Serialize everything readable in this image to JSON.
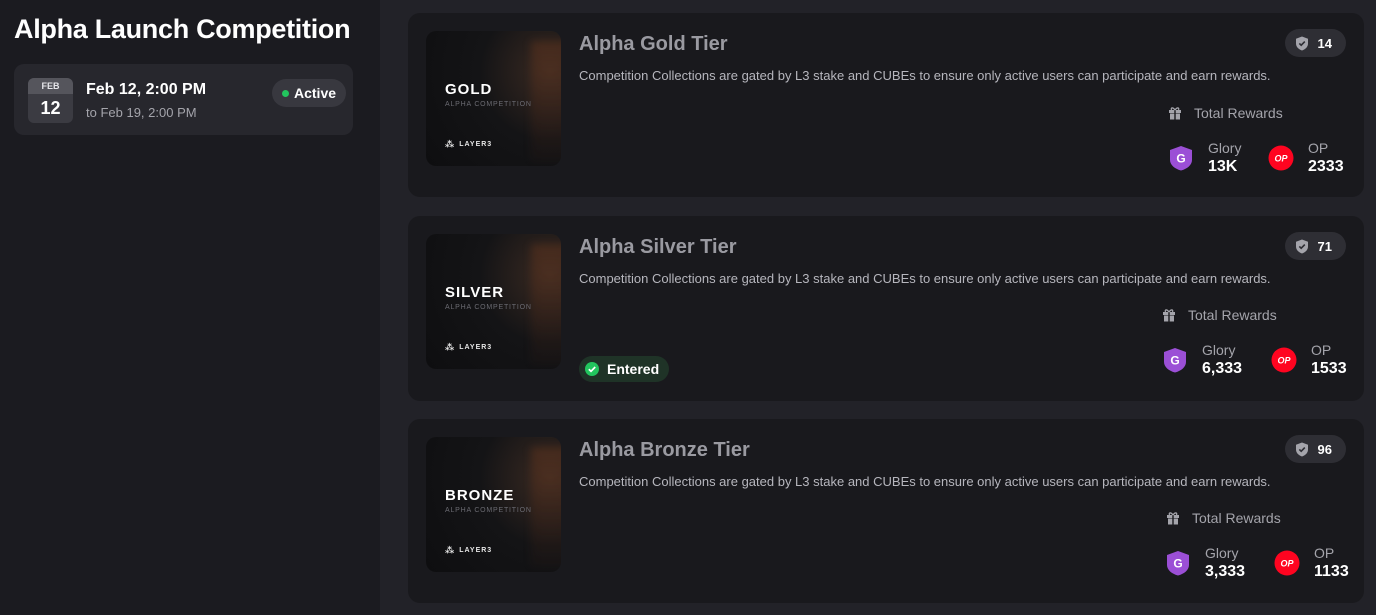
{
  "page": {
    "title": "Alpha Launch Competition"
  },
  "schedule": {
    "month": "FEB",
    "day": "12",
    "start": "Feb 12, 2:00 PM",
    "end": "to Feb 19, 2:00 PM",
    "status": "Active"
  },
  "tiers": [
    {
      "title": "Alpha Gold Tier",
      "thumb_label": "GOLD",
      "thumb_sub": "ALPHA COMPETITION",
      "thumb_logo": "LAYER3",
      "description": "Competition Collections are gated by L3 stake and CUBEs to ensure only active users can participate and earn rewards.",
      "count": "14",
      "rewards_label": "Total Rewards",
      "rewards": [
        {
          "name": "Glory",
          "value": "13K",
          "icon": "glory-icon"
        },
        {
          "name": "OP",
          "value": "2333",
          "icon": "op-icon"
        }
      ]
    },
    {
      "title": "Alpha Silver Tier",
      "thumb_label": "SILVER",
      "thumb_sub": "ALPHA COMPETITION",
      "thumb_logo": "LAYER3",
      "description": "Competition Collections are gated by L3 stake and CUBEs to ensure only active users can participate and earn rewards.",
      "count": "71",
      "entered": "Entered",
      "rewards_label": "Total Rewards",
      "rewards": [
        {
          "name": "Glory",
          "value": "6,333",
          "icon": "glory-icon"
        },
        {
          "name": "OP",
          "value": "1533",
          "icon": "op-icon"
        }
      ]
    },
    {
      "title": "Alpha Bronze Tier",
      "thumb_label": "BRONZE",
      "thumb_sub": "ALPHA COMPETITION",
      "thumb_logo": "LAYER3",
      "description": "Competition Collections are gated by L3 stake and CUBEs to ensure only active users can participate and earn rewards.",
      "count": "96",
      "rewards_label": "Total Rewards",
      "rewards": [
        {
          "name": "Glory",
          "value": "3,333",
          "icon": "glory-icon"
        },
        {
          "name": "OP",
          "value": "1133",
          "icon": "op-icon"
        }
      ]
    }
  ],
  "colors": {
    "active": "#22c55e",
    "glory": "#9b4fd6",
    "op": "#ff0420"
  },
  "icons": {
    "glory_letter": "G",
    "op_letter": "OP"
  }
}
